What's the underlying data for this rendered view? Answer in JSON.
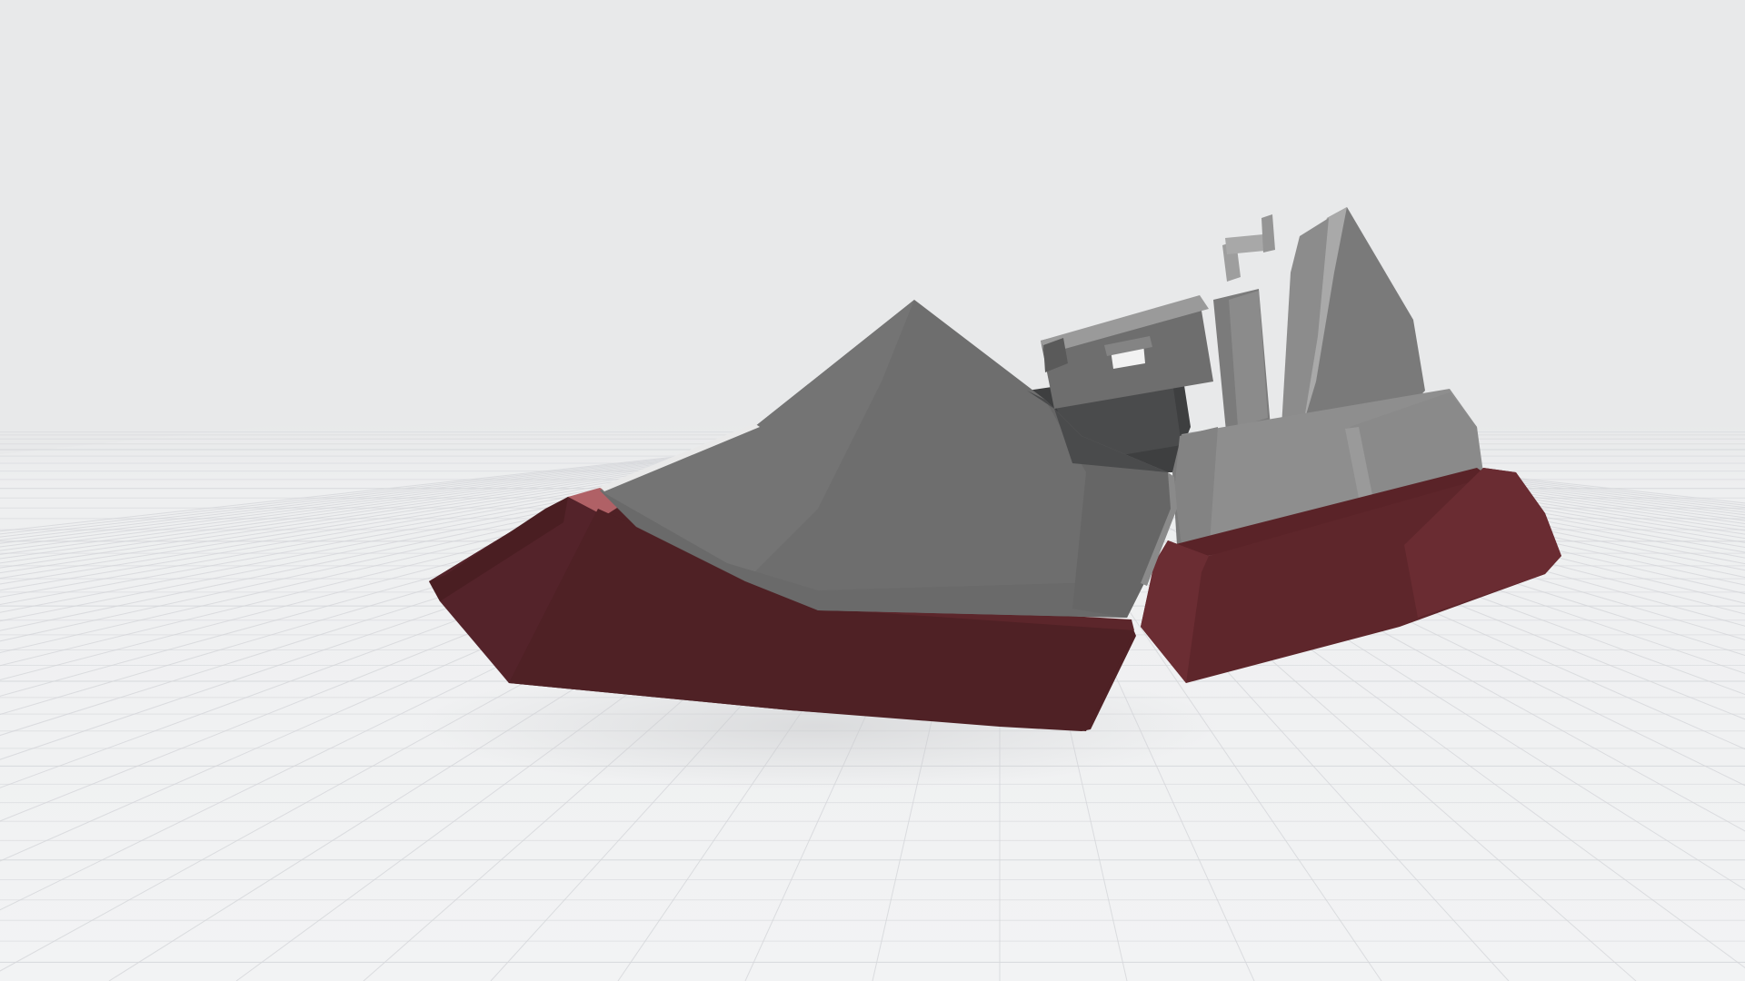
{
  "viewport": {
    "background_color": "#e8e9ea",
    "floor_color": "#eff0f1",
    "grid_color": "#d4d6d9"
  },
  "model": {
    "hull_colors": {
      "dark": "#4f2125",
      "mid": "#5e262b",
      "light": "#6b2d33",
      "highlight": "#b06166"
    },
    "body_colors": {
      "gray_light": "#8f8f8f",
      "gray_mid": "#777777",
      "gray_dark": "#5f5f5f",
      "gray_darker": "#4a4b4c",
      "gray_shadow": "#3e3f40"
    }
  }
}
